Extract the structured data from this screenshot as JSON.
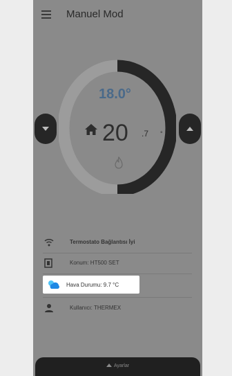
{
  "header": {
    "title": "Manuel Mod"
  },
  "thermostat": {
    "setpoint": "18.0°",
    "current_int": "20",
    "current_dec": ".7",
    "current_unit": "°",
    "progress_fraction": 0.62
  },
  "info": {
    "wifi_status": "Termostato Bağlantısı İyi",
    "model": "Konum: HT500 SET",
    "weather": "Hava Durumu: 9.7 °C",
    "user": "Kullanıcı: THERMEX"
  },
  "bottom": {
    "label": "Ayarlar"
  },
  "colors": {
    "setpoint_blue": "#4a6a8a",
    "ring_dark": "#262626",
    "ring_light": "#9c9c9c",
    "weather_icon_blue": "#1e88e5"
  },
  "icons": [
    "menu-icon",
    "chevron-down-icon",
    "chevron-up-icon",
    "home-icon",
    "flame-icon",
    "wifi-icon",
    "thermostat-device-icon",
    "cloud-sun-icon",
    "user-icon",
    "chevron-up-small-icon"
  ]
}
